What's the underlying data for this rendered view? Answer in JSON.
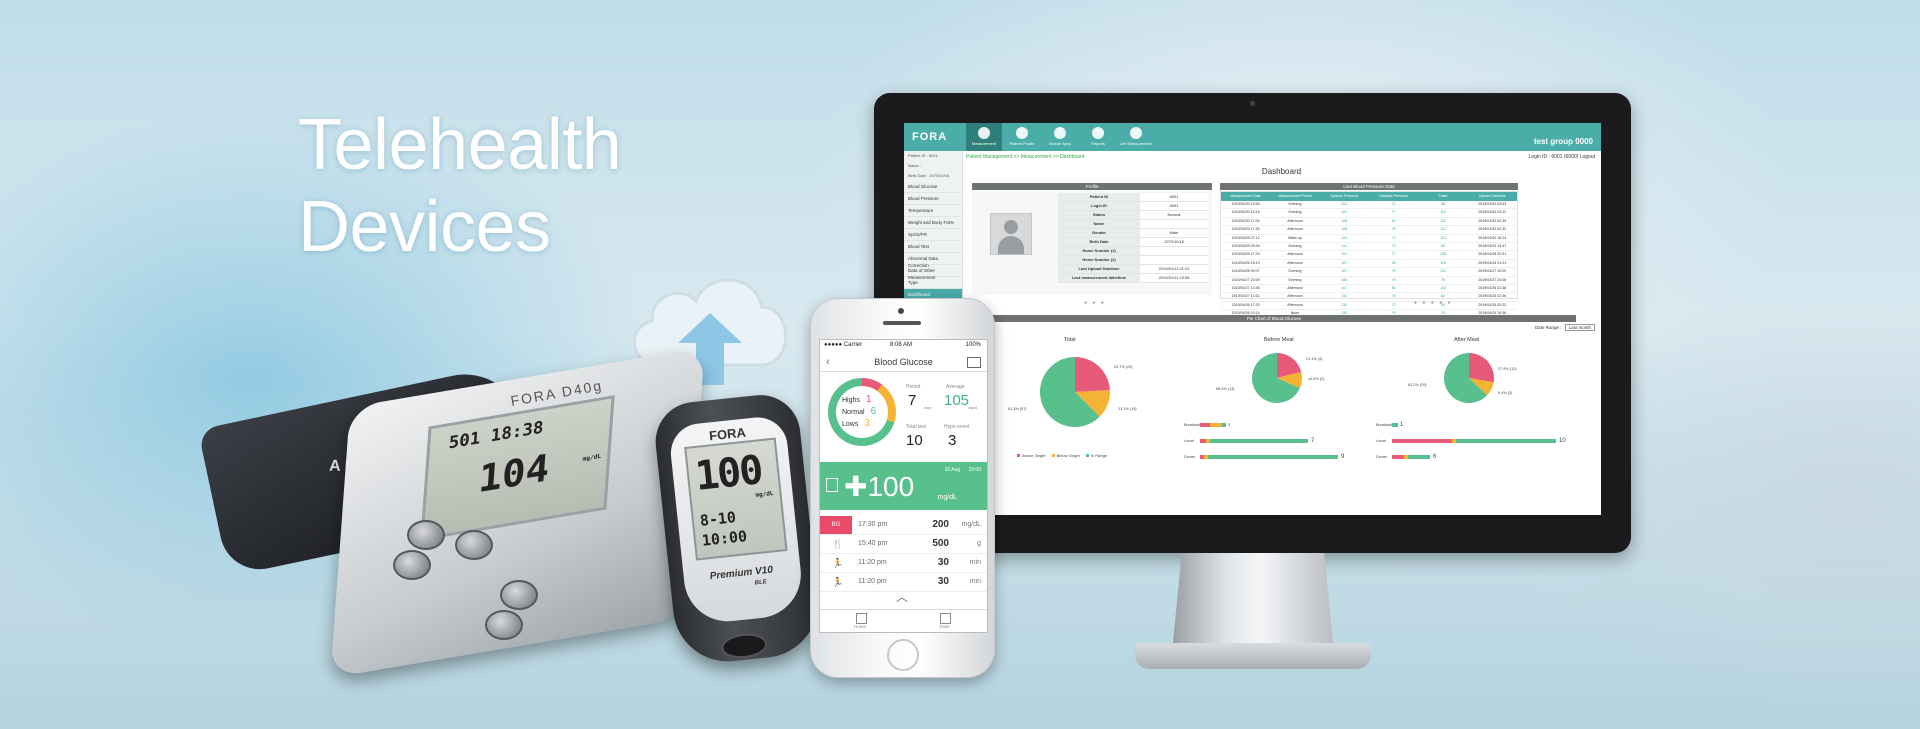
{
  "headline": {
    "line1": "Telehealth",
    "line2": "Devices"
  },
  "colors": {
    "teal": "#4aada8",
    "pink": "#e85a7a",
    "orange": "#f5b336",
    "green": "#57c08c"
  },
  "monitor": {
    "brand": "FORA",
    "nav_tabs": [
      "Measurement",
      "Patient Profile",
      "Mobile Sync",
      "Reports",
      "Life Measurement"
    ],
    "account_label": "test group 0000",
    "breadcrumb": "Patient Management >> Measurement >> Dashboard",
    "login_info": "Login ID : 6001 (6000)   Logout",
    "sidebar": {
      "patient_info": [
        "Patient ID : 6001",
        "Name :",
        "Birth Date : 1970/10/16"
      ],
      "items": [
        "Blood Glucose",
        "Blood Pressure",
        "Temperature",
        "Weight and Body Fat%",
        "SpO2/PR",
        "Blood Test",
        "Abnormal Data Correction",
        "Data of Other Measurement",
        "Type",
        "Dashboard"
      ]
    },
    "dashboard_title": "Dashboard",
    "profile": {
      "header": "Profile",
      "rows": [
        {
          "k": "Patient ID",
          "v": "6001"
        },
        {
          "k": "Login ID",
          "v": "6001"
        },
        {
          "k": "Status",
          "v": "Normal"
        },
        {
          "k": "Name",
          "v": ""
        },
        {
          "k": "Gender",
          "v": "Male"
        },
        {
          "k": "Birth Date",
          "v": "1970/10/16"
        },
        {
          "k": "Home Number (1)",
          "v": ""
        },
        {
          "k": "Home Number (2)",
          "v": ""
        },
        {
          "k": "Last Upload Datetime",
          "v": "2019/01/11 01:22"
        },
        {
          "k": "Last measurement date/time",
          "v": "2019/01/11 23:06"
        }
      ]
    },
    "bp": {
      "header": "Last Blood Pressure Data",
      "columns": [
        "Measurement Date",
        "Measurement Period",
        "Systolic Pressure",
        "Diastolic Pressure",
        "Pulse",
        "Upload Datetime"
      ],
      "rows": [
        [
          "2019/04/30 19:46",
          "Evening",
          "104",
          "71",
          "88",
          "2019/04/30 04:53"
        ],
        [
          "2019/04/30 10:15",
          "Evening",
          "102",
          "77",
          "119",
          "2019/04/30 03:12"
        ],
        [
          "2019/04/30 17:00",
          "Afternoon",
          "108",
          "81",
          "111",
          "2019/04/30 02:39"
        ],
        [
          "2019/04/29 17:30",
          "Afternoon",
          "106",
          "79",
          "113",
          "2019/04/30 02:32"
        ],
        [
          "2019/04/29 07:12",
          "Wake up",
          "124",
          "72",
          "113",
          "2019/04/30 16:14"
        ],
        [
          "2019/04/29 05:45",
          "Evening",
          "111",
          "73",
          "80",
          "2019/04/29 14:47"
        ],
        [
          "2019/04/29 17:29",
          "Afternoon",
          "102",
          "77",
          "128",
          "2019/04/28 02:31"
        ],
        [
          "2019/04/28 16:19",
          "Afternoon",
          "107",
          "94",
          "116",
          "2019/04/28 01:21"
        ],
        [
          "2019/04/28 00:07",
          "Evening",
          "107",
          "79",
          "121",
          "2019/04/27 20:09"
        ],
        [
          "2019/04/27 20:59",
          "Evening",
          "106",
          "79",
          "78",
          "2019/04/27 20:06"
        ],
        [
          "2019/04/27 13:36",
          "Afternoon",
          "107",
          "84",
          "110",
          "2019/04/26 22:38"
        ],
        [
          "2019/04/27 11:52",
          "Afternoon",
          "113",
          "76",
          "82",
          "2019/04/26 22:36"
        ],
        [
          "2019/04/26 17:20",
          "Afternoon",
          "115",
          "72",
          "83",
          "2019/04/26 02:22"
        ],
        [
          "2019/04/26 10:14",
          "Noon",
          "120",
          "79",
          "74",
          "2019/04/25 19:36"
        ]
      ]
    },
    "pie_panel": {
      "header": "Pie Chart of Blood Glucose",
      "date_range_label": "Date Range :",
      "date_range_value": "Last month",
      "charts": [
        {
          "title": "Total",
          "labels": [
            "23.7% (22)",
            "13.1% (14)",
            "61.3% (57)"
          ]
        },
        {
          "title": "Before Meal",
          "labels": [
            "21.1% (4)",
            "10.5% (2)",
            "68.4% (13)"
          ]
        },
        {
          "title": "After Meal",
          "labels": [
            "27.9% (12)",
            "9.4% (3)",
            "63.2% (20)"
          ]
        }
      ],
      "legend": [
        "Above Target",
        "Below Target",
        "In Range"
      ],
      "bars": {
        "before": {
          "labels": [
            "Breakfast",
            "Lunch",
            "Dinner"
          ],
          "values": [
            "3",
            "7",
            "9"
          ]
        },
        "after": {
          "labels": [
            "Breakfast",
            "Lunch",
            "Dinner"
          ],
          "values": [
            "1",
            "10",
            "6"
          ]
        }
      }
    }
  },
  "phone": {
    "carrier": "●●●●● Carrier",
    "time": "8:08 AM",
    "battery": "100%",
    "screen_title": "Blood Glucose",
    "highs_label": "Highs",
    "highs_value": "1",
    "normal_label": "Normal",
    "normal_value": "6",
    "lows_label": "Lows",
    "lows_value": "3",
    "period_label": "Period",
    "period_value": "7",
    "period_unit": "days",
    "average_label": "Average",
    "average_value": "105",
    "average_unit": "mg/dL",
    "total_label": "Total test",
    "total_value": "10",
    "hypo_label": "Hypo event",
    "hypo_value": "3",
    "latest_value": "100",
    "latest_date": "10 Aug",
    "latest_time": "10:00",
    "latest_unit": "mg/dL",
    "rows": [
      {
        "tag": "BG",
        "time": "17:30 pm",
        "value": "200",
        "unit": "mg/dL"
      },
      {
        "icon": "fork-icon",
        "time": "15:40 pm",
        "value": "500",
        "unit": "g"
      },
      {
        "icon": "run-icon",
        "time": "11:20 pm",
        "value": "30",
        "unit": "min"
      },
      {
        "icon": "run-icon",
        "time": "11:20 pm",
        "value": "30",
        "unit": "min"
      }
    ],
    "tabbar": [
      "Home",
      "Tools"
    ]
  },
  "bp_meter": {
    "brand": "FORA D40g",
    "lcd_small": "501 18:38",
    "lcd_big": "104",
    "lcd_unit": "mg/dL",
    "cuff_text": "ARM"
  },
  "glucometer": {
    "brand": "FORA",
    "reading": "100",
    "unit": "mg/dL",
    "date": "8-10",
    "time": "10:00",
    "model": "Premium V10",
    "ble": "BLE"
  }
}
